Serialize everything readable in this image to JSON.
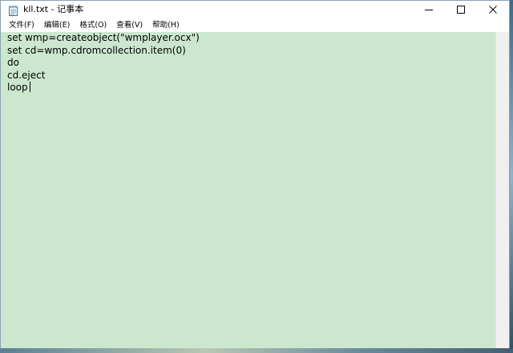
{
  "window": {
    "title": "kll.txt - 记事本"
  },
  "menu": {
    "items": [
      {
        "label": "文件(F)"
      },
      {
        "label": "编辑(E)"
      },
      {
        "label": "格式(O)"
      },
      {
        "label": "查看(V)"
      },
      {
        "label": "帮助(H)"
      }
    ]
  },
  "editor": {
    "lines": [
      "set wmp=createobject(\"wmplayer.ocx\")",
      "set cd=wmp.cdromcollection.item(0)",
      "do",
      "cd.eject",
      "loop"
    ],
    "background_color": "#cbe8cf"
  },
  "icons": {
    "app": "notepad-icon",
    "minimize": "minimize-icon",
    "maximize": "maximize-icon",
    "close": "close-icon"
  }
}
